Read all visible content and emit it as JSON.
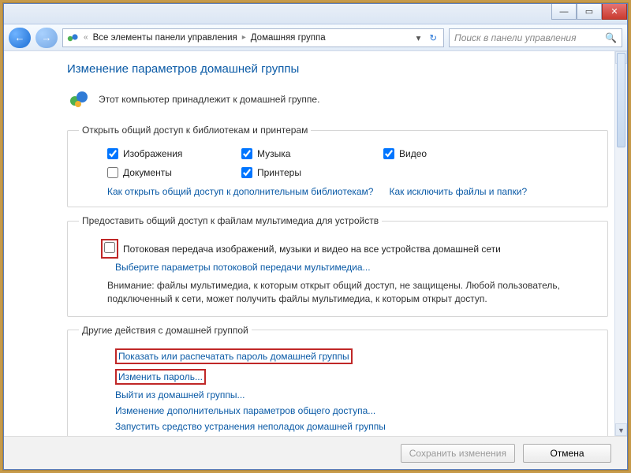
{
  "titlebar": {
    "min": "—",
    "max": "▭",
    "close": "✕"
  },
  "nav": {
    "crumb_all": "Все элементы панели управления",
    "crumb_hg": "Домашняя группа",
    "search_placeholder": "Поиск в панели управления"
  },
  "page": {
    "heading": "Изменение параметров домашней группы",
    "intro": "Этот компьютер принадлежит к домашней группе."
  },
  "libs": {
    "legend": "Открыть общий доступ к библиотекам и принтерам",
    "pictures": "Изображения",
    "music": "Музыка",
    "video": "Видео",
    "documents": "Документы",
    "printers": "Принтеры",
    "link_more": "Как открыть общий доступ к дополнительным библиотекам?",
    "link_exclude": "Как исключить файлы и папки?"
  },
  "stream": {
    "legend": "Предоставить общий доступ к файлам мультимедиа для устройств",
    "cb": "Потоковая передача изображений, музыки и видео на все устройства домашней сети",
    "link": "Выберите параметры потоковой передачи мультимедиа...",
    "note": "Внимание: файлы мультимедиа, к которым открыт общий доступ, не защищены. Любой пользователь, подключенный к сети, может получить файлы мультимедиа, к которым открыт доступ."
  },
  "other": {
    "legend": "Другие действия с домашней группой",
    "show_pwd": "Показать или распечатать пароль домашней группы",
    "change_pwd": "Изменить пароль...",
    "leave": "Выйти из домашней группы...",
    "adv": "Изменение дополнительных параметров общего доступа...",
    "trouble": "Запустить средство устранения неполадок домашней группы"
  },
  "footer": {
    "save": "Сохранить изменения",
    "cancel": "Отмена"
  }
}
